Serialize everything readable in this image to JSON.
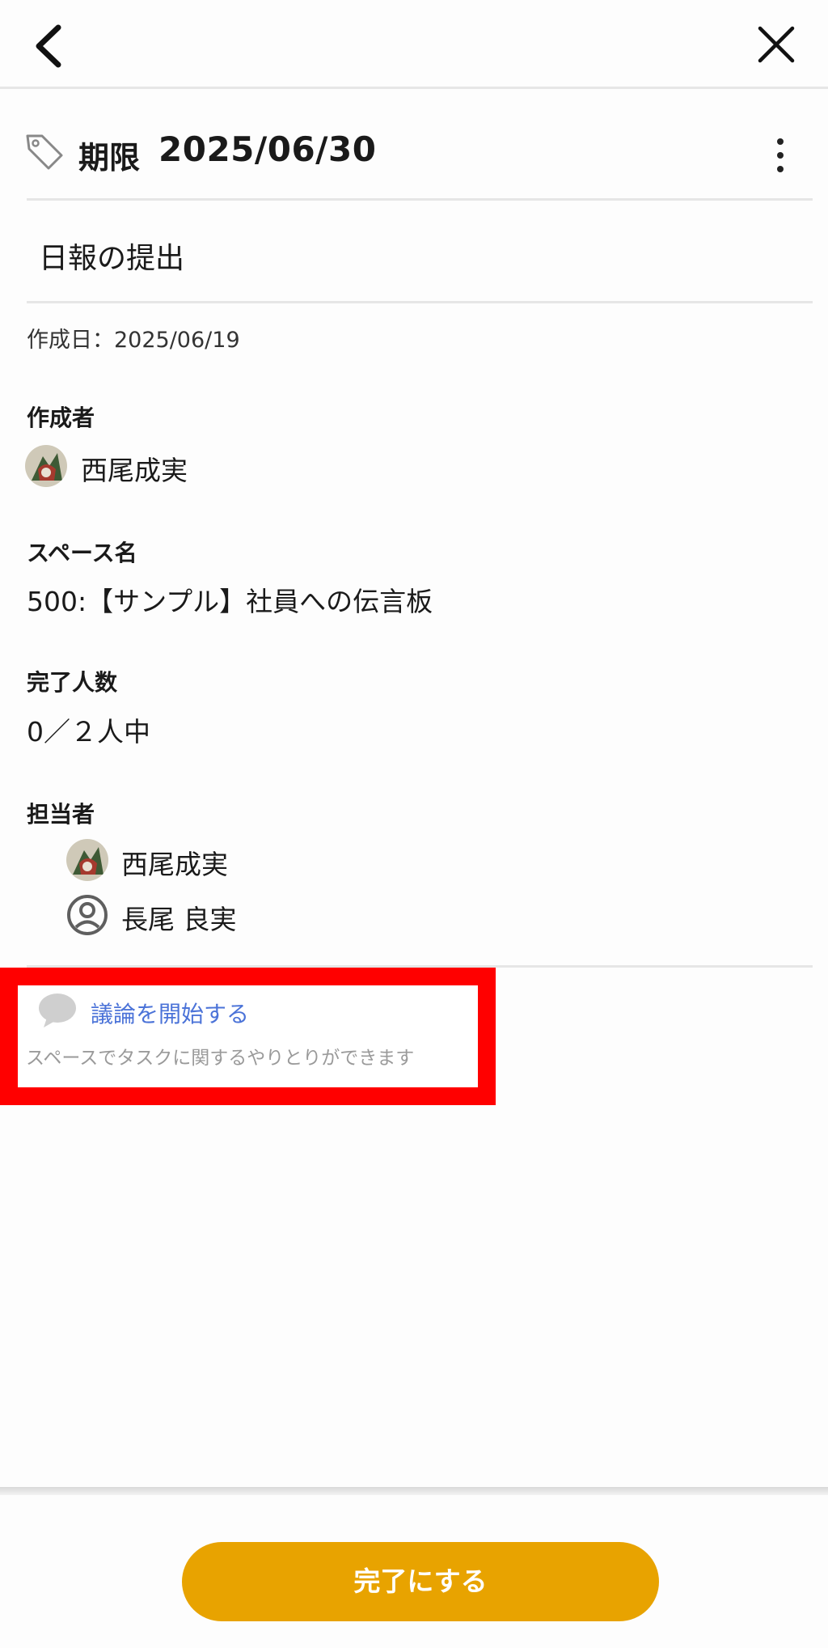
{
  "header": {
    "back_icon": "chevron-left-icon",
    "close_icon": "close-icon"
  },
  "task": {
    "due_label": "期限",
    "due_date": "2025/06/30",
    "title": "日報の提出",
    "created": "作成日：2025/06/19"
  },
  "creator": {
    "label": "作成者",
    "name": "西尾成実"
  },
  "space": {
    "label": "スペース名",
    "value": "500:【サンプル】社員への伝言板"
  },
  "completion": {
    "label": "完了人数",
    "value": "0／２人中"
  },
  "assignees": {
    "label": "担当者",
    "items": [
      {
        "name": "西尾成実",
        "avatar": "photo"
      },
      {
        "name": "長尾 良実",
        "avatar": "default-user-icon"
      }
    ]
  },
  "discussion": {
    "title": "議論を開始する",
    "subtitle": "スペースでタスクに関するやりとりができます",
    "highlight_color": "#ff0000",
    "link_color": "#4b73d8"
  },
  "footer": {
    "complete_label": "完了にする",
    "button_color": "#e8a300"
  }
}
